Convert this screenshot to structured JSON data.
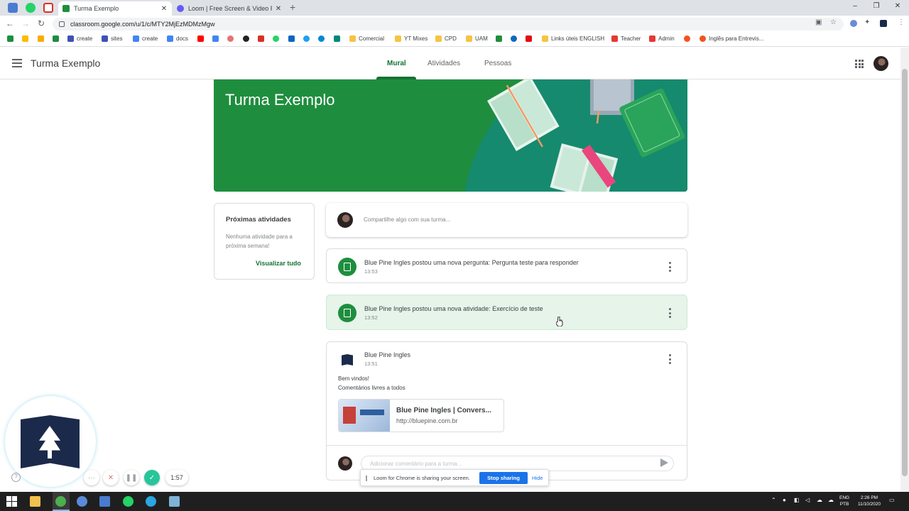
{
  "browser": {
    "tabs": [
      {
        "title": "Turma Exemplo",
        "active": true
      },
      {
        "title": "Loom | Free Screen & Video Reco",
        "active": false
      }
    ],
    "url": "classroom.google.com/u/1/c/MTY2MjEzMDMzMgw",
    "bookmarks": [
      "create",
      "sites",
      "create",
      "docs",
      "Comercial",
      "YT Mixes",
      "CPD",
      "UAM",
      "Links úteis ENGLISH",
      "Teacher",
      "Admin",
      "Inglês para Entrevis..."
    ]
  },
  "header": {
    "class_title": "Turma Exemplo",
    "tabs": [
      "Mural",
      "Atividades",
      "Pessoas"
    ],
    "active_tab": "Mural"
  },
  "banner": {
    "title": "Turma Exemplo",
    "color": "#1e8e3e"
  },
  "upcoming": {
    "title": "Próximas atividades",
    "text": "Nenhuma atividade para a próxima semana!",
    "link": "Visualizar tudo"
  },
  "share_box": {
    "placeholder": "Compartilhe algo com sua turma..."
  },
  "stream": [
    {
      "text": "Blue Pine Ingles postou uma nova pergunta: Pergunta teste para responder",
      "time": "13:53",
      "icon": "question-icon"
    },
    {
      "text": "Blue Pine Ingles postou uma nova atividade: Exercício de teste",
      "time": "13:52",
      "icon": "assignment-icon"
    }
  ],
  "announcement": {
    "author": "Blue Pine Ingles",
    "time": "13:51",
    "body_line1": "Bem vindos!",
    "body_line2": "Comentários livres a todos",
    "attachment_title": "Blue Pine Ingles | Convers...",
    "attachment_url": "http://bluepine.com.br",
    "comment_placeholder": "Adicionar comentário para a turma..."
  },
  "loom": {
    "timer": "1:57",
    "share_text": "Loom for Chrome is sharing your screen.",
    "stop_label": "Stop sharing",
    "hide_label": "Hide"
  },
  "taskbar": {
    "lang_line1": "ENG",
    "lang_line2": "PTB",
    "time": "2:26 PM",
    "date": "11/10/2020"
  },
  "colors": {
    "accent": "#137333",
    "primary": "#1e8e3e",
    "loom_blue": "#1a73e8"
  }
}
